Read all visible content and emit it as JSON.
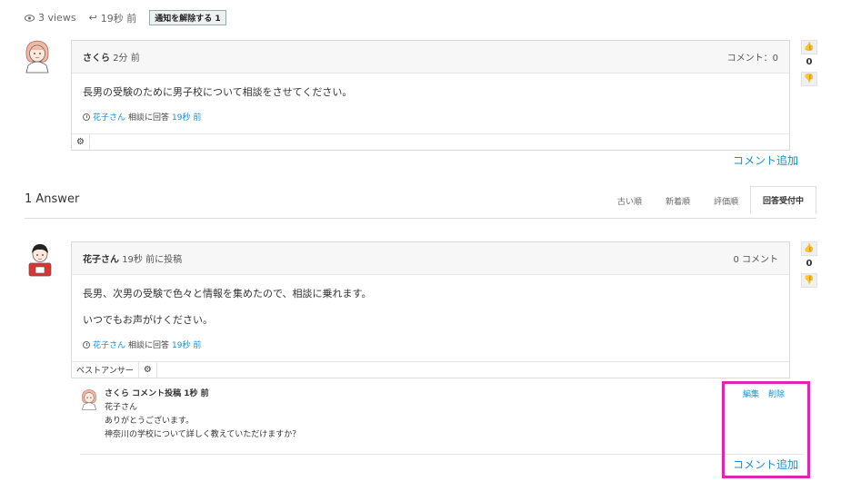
{
  "question_meta": {
    "views": "3 views",
    "posted": "19秒 前",
    "notify_button": "通知を解除する 1"
  },
  "question": {
    "author": "さくら",
    "time": "2分 前",
    "comment_count": "コメント：0",
    "body": "長男の受験のために男子校について相談をさせてください。",
    "answered_by": "花子さん",
    "answered_text": "相談に回答",
    "answered_time": "19秒 前",
    "votes": "0",
    "add_comment": "コメント追加"
  },
  "answers_header": {
    "title": "1 Answer",
    "tabs": [
      "古い順",
      "新着順",
      "評価順",
      "回答受付中"
    ]
  },
  "answer": {
    "author": "花子さん",
    "time": "19秒 前に投稿",
    "comment_count": "0 コメント",
    "body_lines": [
      "長男、次男の受験で色々と情報を集めたので、相談に乗れます。",
      "いつでもお声がけください。"
    ],
    "answered_by": "花子さん",
    "answered_text": "相談に回答",
    "answered_time": "19秒 前",
    "best_answer_label": "ベストアンサー",
    "votes": "0",
    "add_comment": "コメント追加"
  },
  "comment": {
    "header": "さくら コメント投稿 1秒 前",
    "lines": [
      "花子さん",
      "ありがとうございます。",
      "神奈川の学校について詳しく教えていただけますか？"
    ],
    "edit_label": "編集",
    "delete_label": "削除"
  },
  "colors": {
    "link": "#1a8fd1",
    "highlight": "#e223b4"
  }
}
